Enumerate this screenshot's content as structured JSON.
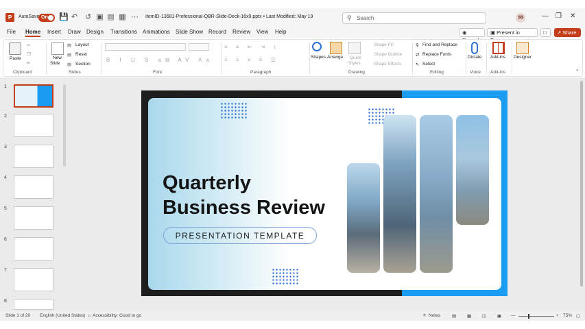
{
  "titlebar": {
    "autosave_label": "AutoSave",
    "autosave_state": "On",
    "document_title": "ItemID-13681-Professional-QBR-Slide-Deck-16x9.pptx • Last Modified: May 19",
    "search_placeholder": "Search",
    "user_initials": "SB"
  },
  "menu": {
    "tabs": [
      "File",
      "Home",
      "Insert",
      "Draw",
      "Design",
      "Transitions",
      "Animations",
      "Slide Show",
      "Record",
      "Review",
      "View",
      "Help"
    ],
    "record_label": "Record",
    "present_label": "Present in Teams",
    "share_label": "Share"
  },
  "ribbon": {
    "clipboard": {
      "paste": "Paste",
      "group": "Clipboard"
    },
    "slides": {
      "new_slide_1": "New",
      "new_slide_2": "Slide",
      "layout": "Layout",
      "reset": "Reset",
      "section": "Section",
      "group": "Slides"
    },
    "font": {
      "group": "Font"
    },
    "paragraph": {
      "group": "Paragraph"
    },
    "drawing": {
      "shapes": "Shapes",
      "arrange": "Arrange",
      "quick_styles_1": "Quick",
      "quick_styles_2": "Styles",
      "shape_fill": "Shape Fill",
      "shape_outline": "Shape Outline",
      "shape_effects": "Shape Effects",
      "group": "Drawing"
    },
    "editing": {
      "find_replace": "Find and Replace",
      "replace_fonts": "Replace Fonts",
      "select": "Select",
      "group": "Editing"
    },
    "voice": {
      "dictate": "Dictate",
      "group": "Voice"
    },
    "addins": {
      "addins": "Add-ins",
      "group": "Add-ins"
    },
    "designer": {
      "designer": "Designer"
    }
  },
  "thumbnails": [
    "1",
    "2",
    "3",
    "4",
    "5",
    "6",
    "7",
    "8"
  ],
  "slide": {
    "title_line1": "Quarterly",
    "title_line2": "Business Review",
    "subtitle": "PRESENTATION TEMPLATE"
  },
  "status": {
    "slide_counter": "Slide 1 of 20",
    "language": "English (United States)",
    "accessibility": "Accessibility: Good to go",
    "notes": "Notes",
    "zoom": "75%"
  },
  "colors": {
    "accent": "#c43e1c",
    "slide_blue": "#1a9cf0"
  }
}
